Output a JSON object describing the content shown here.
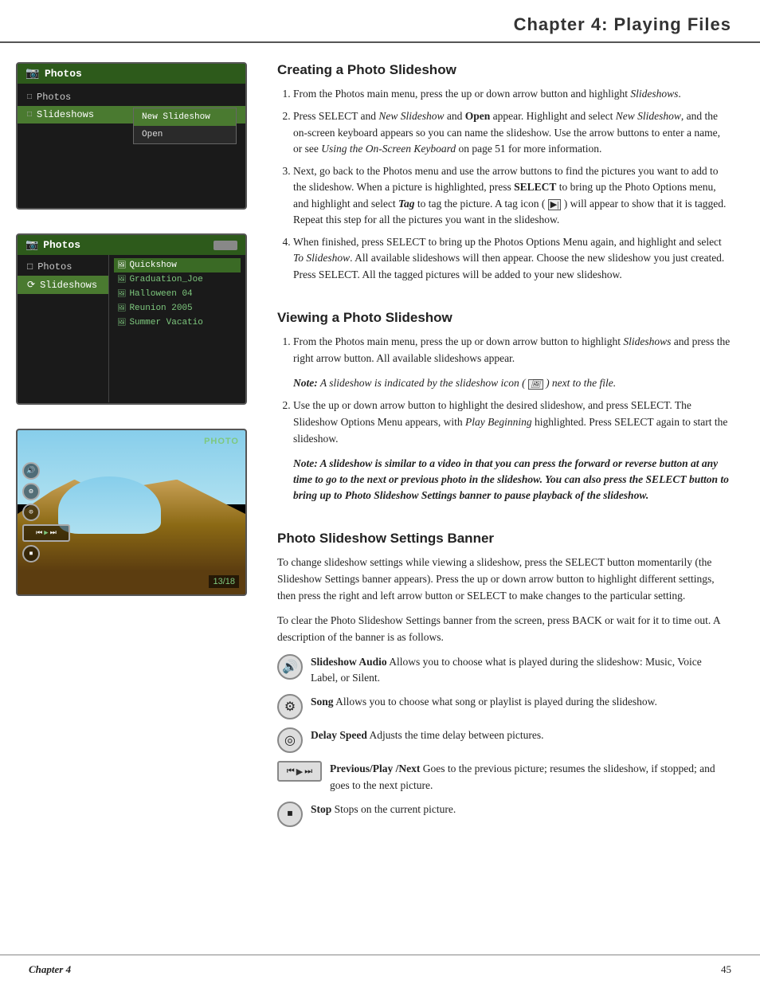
{
  "header": {
    "title": "Chapter 4: Playing Files"
  },
  "screen1": {
    "header": "Photos",
    "menu_items": [
      {
        "label": "Photos",
        "icon": "□"
      },
      {
        "label": "Slideshows",
        "icon": "□",
        "selected": true
      }
    ],
    "submenu": [
      {
        "label": "New Slideshow",
        "highlighted": true
      },
      {
        "label": "Open"
      }
    ]
  },
  "screen2": {
    "header": "Photos",
    "left_menu": [
      {
        "label": "Photos"
      },
      {
        "label": "Slideshows",
        "selected": true
      }
    ],
    "slideshows": [
      {
        "label": "Quickshow",
        "active": true
      },
      {
        "label": "Graduation_Joe"
      },
      {
        "label": "Halloween 04"
      },
      {
        "label": "Reunion 2005"
      },
      {
        "label": "Summer Vacatio"
      }
    ]
  },
  "screen3": {
    "label": "PHOTO",
    "counter": "13/18",
    "controls": [
      "⏮",
      "▶",
      "⏭"
    ],
    "icons": [
      "🔊",
      "⚙",
      "⏸"
    ]
  },
  "section_creating": {
    "title": "Creating a Photo Slideshow",
    "steps": [
      {
        "num": 1,
        "text": "From the Photos main menu, press the up or down arrow button and highlight Slideshows."
      },
      {
        "num": 2,
        "text": "Press SELECT and New Slideshow and Open appear. Highlight and select New Slideshow,  and the on-screen keyboard appears so you can name the slideshow. Use the arrow buttons to enter a name, or see Using the On-Screen Keyboard on page 51 for more information."
      },
      {
        "num": 3,
        "text": "Next, go back to the Photos menu and use the arrow buttons to find the pictures you want to add to the slideshow. When a picture is highlighted, press SELECT to bring up the Photo Options menu, and highlight and select Tag to tag the picture. A tag icon ( ) will appear to show that it is tagged. Repeat this step for all the pictures you want in the slideshow."
      },
      {
        "num": 4,
        "text": "When finished, press SELECT to bring up the Photos Options Menu again, and highlight and select To Slideshow. All available slideshows will then appear. Choose the new slideshow you just created. Press SELECT. All the tagged pictures will be added to your new slideshow."
      }
    ]
  },
  "section_viewing": {
    "title": "Viewing a Photo Slideshow",
    "steps": [
      {
        "num": 1,
        "text_plain": "From the Photos main menu, press the up or down arrow button to highlight ",
        "text_italic": "Slideshows",
        "text_plain2": " and press the right arrow button. All available slideshows appear.",
        "note": "Note: A slideshow is indicated by the slideshow icon (   ) next to the file."
      },
      {
        "num": 2,
        "text": "Use the up or down arrow button to highlight the desired slideshow, and press SELECT. The Slideshow Options Menu appears, with Play Beginning highlighted. Press SELECT again to start the slideshow.",
        "note": "Note: A slideshow is similar to a video in that you can press the forward or reverse button at any time to go to the next or previous photo in the slideshow. You can also press the SELECT button to bring up to Photo Slideshow Settings banner to pause playback of the slideshow."
      }
    ]
  },
  "section_banner": {
    "title": "Photo Slideshow Settings Banner",
    "para1": "To change slideshow settings while viewing a slideshow, press the SELECT button momentarily (the Slideshow Settings banner appears). Press the up or down arrow button to highlight different settings, then press the right and left arrow button or SELECT to make changes to the particular setting.",
    "para2": "To clear the Photo Slideshow Settings banner from the screen, press BACK or wait for it to time out. A description of the banner is as follows.",
    "icons": [
      {
        "icon_type": "circle",
        "icon_label": "♪",
        "bold_text": "Slideshow Audio",
        "desc": "  Allows you to choose what is played during the slideshow: Music, Voice Label, or Silent."
      },
      {
        "icon_type": "circle",
        "icon_label": "⚙",
        "bold_text": "Song",
        "desc": "  Allows you to choose what song or playlist is played during the slideshow."
      },
      {
        "icon_type": "circle",
        "icon_label": "◎",
        "bold_text": "Delay Speed",
        "desc": "  Adjusts the time delay between pictures."
      },
      {
        "icon_type": "wide",
        "bold_text": "Previous/Play /Next",
        "desc": "  Goes to the previous picture; resumes the slideshow, if stopped; and goes to the next picture."
      },
      {
        "icon_type": "circle",
        "icon_label": "■",
        "bold_text": "Stop",
        "desc": "  Stops on the current picture."
      }
    ]
  },
  "footer": {
    "chapter_label": "Chapter 4",
    "page_number": "45"
  }
}
